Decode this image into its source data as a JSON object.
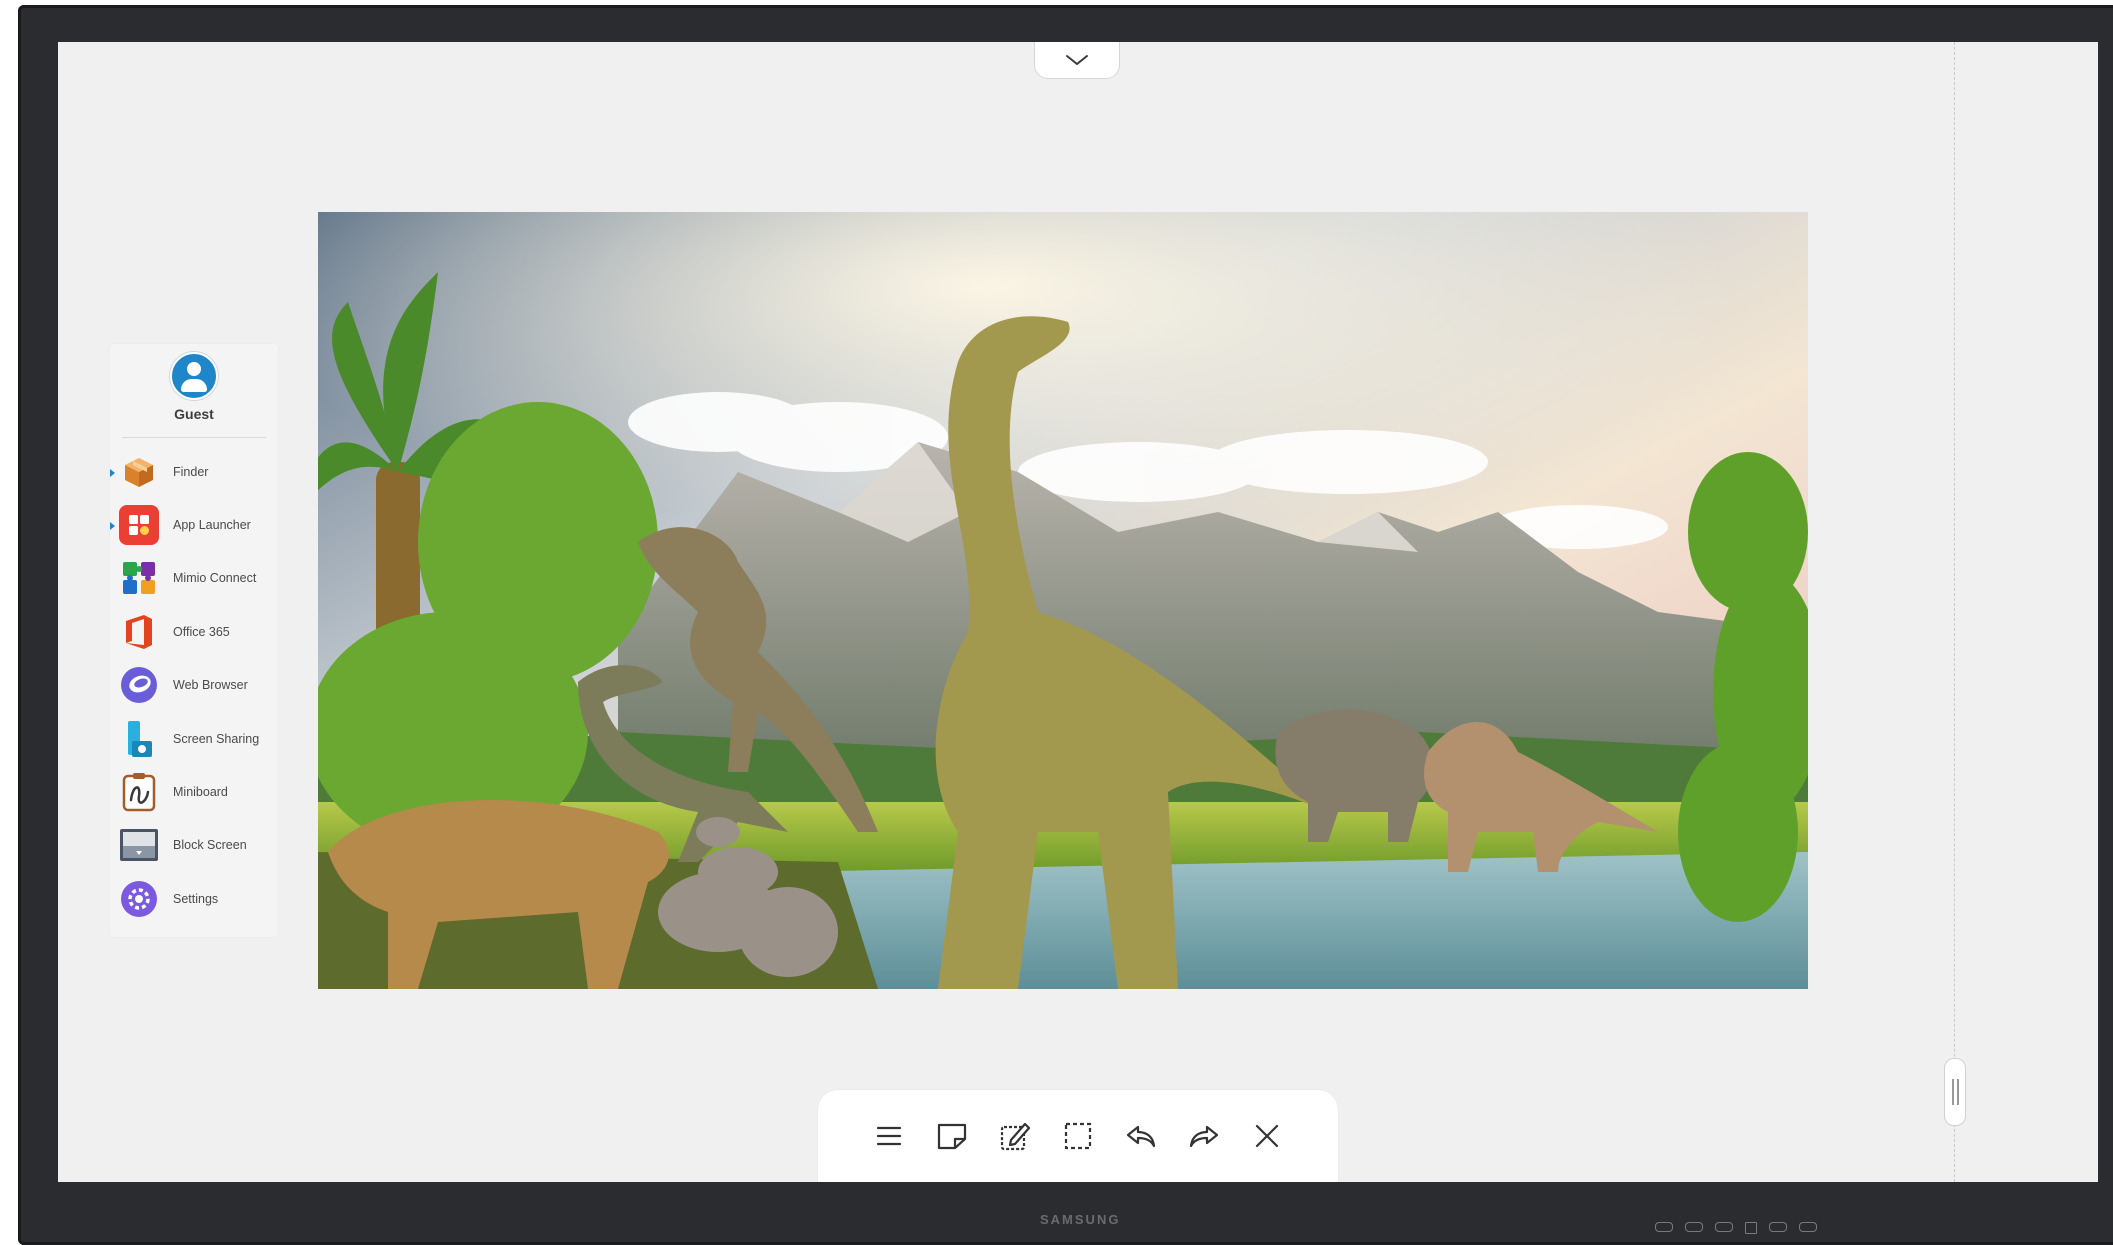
{
  "device": {
    "brand": "SAMSUNG"
  },
  "sidebar": {
    "user": {
      "name": "Guest"
    },
    "items": [
      {
        "label": "Finder",
        "icon": "box-icon",
        "color": "#e6903a",
        "running": true
      },
      {
        "label": "App Launcher",
        "icon": "app-grid-icon",
        "color": "#ea3f32",
        "running": true
      },
      {
        "label": "Mimio Connect",
        "icon": "puzzle-icon",
        "color": "#2aa54a",
        "running": false
      },
      {
        "label": "Office 365",
        "icon": "office-icon",
        "color": "#e2441f",
        "running": false
      },
      {
        "label": "Web Browser",
        "icon": "globe-icon",
        "color": "#6a5ed8",
        "running": false
      },
      {
        "label": "Screen Sharing",
        "icon": "screen-share-icon",
        "color": "#2ab0df",
        "running": false
      },
      {
        "label": "Miniboard",
        "icon": "clipboard-icon",
        "color": "#a55b2e",
        "running": false
      },
      {
        "label": "Block Screen",
        "icon": "block-screen-icon",
        "color": "#4b5463",
        "running": false
      },
      {
        "label": "Settings",
        "icon": "gear-icon",
        "color": "#7c5ae0",
        "running": false
      }
    ]
  },
  "toolbar": {
    "buttons": [
      {
        "name": "menu",
        "icon": "menu-icon"
      },
      {
        "name": "sticky-note",
        "icon": "sticky-note-icon"
      },
      {
        "name": "annotate",
        "icon": "edit-note-icon"
      },
      {
        "name": "select",
        "icon": "select-area-icon"
      },
      {
        "name": "undo",
        "icon": "undo-icon"
      },
      {
        "name": "redo",
        "icon": "redo-icon"
      },
      {
        "name": "close",
        "icon": "close-icon"
      }
    ]
  },
  "colors": {
    "accent": "#1f86c9",
    "screen_bg": "#f0f0f0",
    "bezel": "#2b2c2f"
  }
}
